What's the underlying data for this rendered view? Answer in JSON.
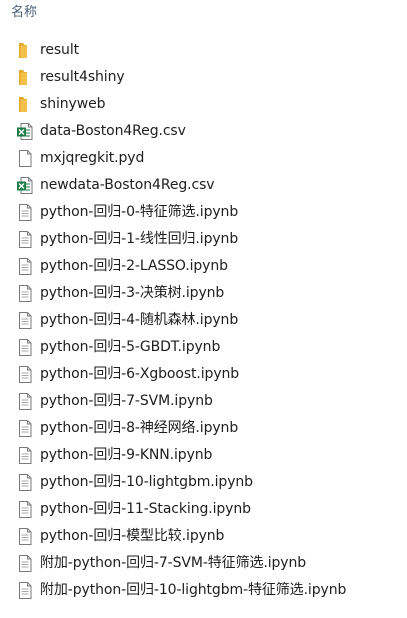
{
  "header": {
    "name_column": "名称"
  },
  "colors": {
    "folder": "#f5c04a",
    "folder_dark": "#e2a82c",
    "excel_green": "#1d7a45",
    "doc_outline": "#7a7a7a",
    "header_text": "#4c607a"
  },
  "files": [
    {
      "name": "result",
      "icon": "folder-icon"
    },
    {
      "name": "result4shiny",
      "icon": "folder-icon"
    },
    {
      "name": "shinyweb",
      "icon": "folder-icon"
    },
    {
      "name": "data-Boston4Reg.csv",
      "icon": "excel-csv-icon"
    },
    {
      "name": "mxjqregkit.pyd",
      "icon": "blank-file-icon"
    },
    {
      "name": "newdata-Boston4Reg.csv",
      "icon": "excel-csv-icon"
    },
    {
      "name": "python-回归-0-特征筛选.ipynb",
      "icon": "document-icon"
    },
    {
      "name": "python-回归-1-线性回归.ipynb",
      "icon": "document-icon"
    },
    {
      "name": "python-回归-2-LASSO.ipynb",
      "icon": "document-icon"
    },
    {
      "name": "python-回归-3-决策树.ipynb",
      "icon": "document-icon"
    },
    {
      "name": "python-回归-4-随机森林.ipynb",
      "icon": "document-icon"
    },
    {
      "name": "python-回归-5-GBDT.ipynb",
      "icon": "document-icon"
    },
    {
      "name": "python-回归-6-Xgboost.ipynb",
      "icon": "document-icon"
    },
    {
      "name": "python-回归-7-SVM.ipynb",
      "icon": "document-icon"
    },
    {
      "name": "python-回归-8-神经网络.ipynb",
      "icon": "document-icon"
    },
    {
      "name": "python-回归-9-KNN.ipynb",
      "icon": "document-icon"
    },
    {
      "name": "python-回归-10-lightgbm.ipynb",
      "icon": "document-icon"
    },
    {
      "name": "python-回归-11-Stacking.ipynb",
      "icon": "document-icon"
    },
    {
      "name": "python-回归-模型比较.ipynb",
      "icon": "document-icon"
    },
    {
      "name": "附加-python-回归-7-SVM-特征筛选.ipynb",
      "icon": "document-icon"
    },
    {
      "name": "附加-python-回归-10-lightgbm-特征筛选.ipynb",
      "icon": "document-icon"
    }
  ]
}
